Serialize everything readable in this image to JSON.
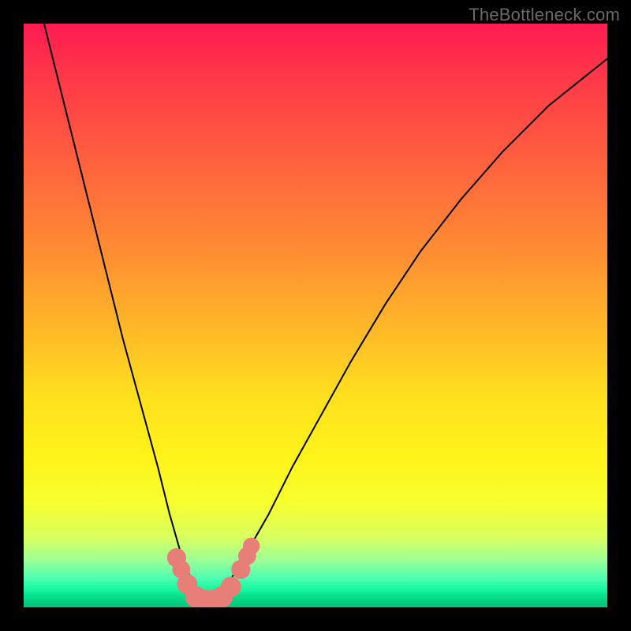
{
  "watermark": "TheBottleneck.com",
  "colors": {
    "frame": "#000000",
    "gradient_top": "#ff1b52",
    "gradient_mid": "#fff31a",
    "gradient_bottom": "#04c478",
    "curve": "#000000",
    "marker": "#e77e77"
  },
  "chart_data": {
    "type": "line",
    "title": "",
    "xlabel": "",
    "ylabel": "",
    "xlim": [
      0,
      100
    ],
    "ylim": [
      0,
      100
    ],
    "grid": false,
    "legend": false,
    "series": [
      {
        "name": "curve",
        "x": [
          2,
          5,
          8,
          11,
          14,
          17,
          20,
          23,
          25,
          27,
          29,
          30,
          31,
          32,
          33,
          35,
          38,
          42,
          46,
          51,
          56,
          62,
          68,
          75,
          82,
          90,
          100
        ],
        "y": [
          106,
          94,
          82,
          70,
          58,
          46,
          35,
          24,
          16,
          9,
          4,
          2,
          1.2,
          1.2,
          2,
          4,
          9,
          16,
          24,
          33,
          42,
          52,
          61,
          70,
          78,
          86,
          94
        ]
      }
    ],
    "markers": [
      {
        "x": 26.2,
        "y": 8.5,
        "r": 1.1
      },
      {
        "x": 27.0,
        "y": 6.5,
        "r": 1.0
      },
      {
        "x": 28.0,
        "y": 4.0,
        "r": 1.2
      },
      {
        "x": 29.5,
        "y": 1.8,
        "r": 1.3
      },
      {
        "x": 31.0,
        "y": 1.2,
        "r": 1.3
      },
      {
        "x": 32.5,
        "y": 1.2,
        "r": 1.3
      },
      {
        "x": 34.0,
        "y": 1.8,
        "r": 1.3
      },
      {
        "x": 35.5,
        "y": 3.5,
        "r": 1.2
      },
      {
        "x": 37.2,
        "y": 6.5,
        "r": 1.1
      },
      {
        "x": 38.3,
        "y": 8.8,
        "r": 1.0
      },
      {
        "x": 39.0,
        "y": 10.5,
        "r": 0.9
      }
    ],
    "x_fraction_of_minimum": 0.315
  }
}
